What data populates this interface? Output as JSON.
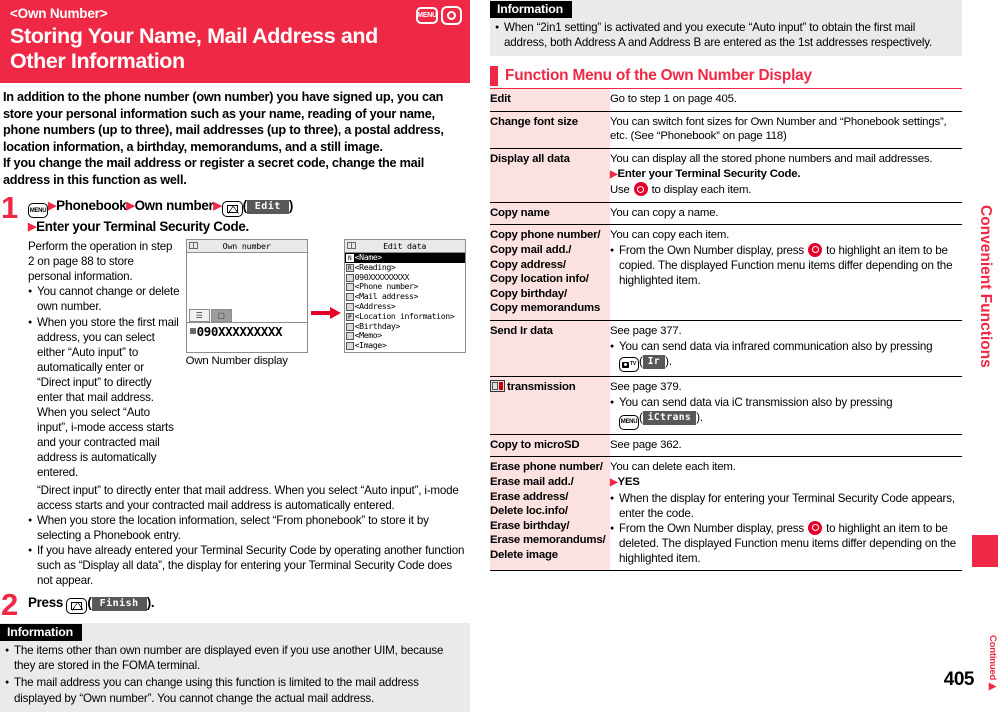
{
  "header": {
    "chapter_tag": "<Own Number>",
    "title_line1": "Storing Your Name, Mail Address and",
    "title_line2": "Other Information",
    "key_menu_label": "MENU",
    "accent_color": "#ef2945"
  },
  "intro": {
    "paragraph1": "In addition to the phone number (own number) you have signed up, you can store your personal information such as your name, reading of your name, phone numbers (up to three), mail addresses (up to three), a postal address, location information, a birthday, memorandums, and a still image.",
    "paragraph2": "If you change the mail address or register a secret code, change the mail address in this function as well."
  },
  "steps": [
    {
      "number": "1",
      "head_parts": {
        "key1": "MENU",
        "item1": "Phonebook",
        "item2": "Own number",
        "softkey": "Edit",
        "line2": "Enter your Terminal Security Code."
      },
      "body": "Perform the operation in step 2 on page 88 to store personal information.",
      "bullets": [
        "You cannot change or delete own number.",
        "When you store the first mail address, you can select either “Auto input” to automatically enter or “Direct input” to directly enter that mail address. When you select “Auto input”, i-mode access starts and your contracted mail address is automatically entered.",
        "When you store the location information, select “From phonebook” to store it by selecting a Phonebook entry.",
        "If you have already entered your Terminal Security Code by operating another function such as “Display all data”, the display for entering your Terminal Security Code does not appear."
      ]
    },
    {
      "number": "2",
      "head_parts": {
        "press_label": "Press",
        "softkey": "Finish",
        "trailing": ")."
      }
    }
  ],
  "screens": {
    "own_number": {
      "title": "Own number",
      "number": "090XXXXXXXXX",
      "tab_list_icon": "list-icon",
      "tab_photo_icon": "photo-icon"
    },
    "edit_data": {
      "title": "Edit data",
      "rows": [
        {
          "icon": "N",
          "label": "<Name>",
          "highlighted": true
        },
        {
          "icon": "R",
          "label": "<Reading>",
          "highlighted": false
        },
        {
          "icon": "☎",
          "label": "090XXXXXXXXX",
          "highlighted": false
        },
        {
          "icon": "☎",
          "label": "<Phone number>",
          "highlighted": false
        },
        {
          "icon": "✉",
          "label": "<Mail address>",
          "highlighted": false
        },
        {
          "icon": "■",
          "label": "<Address>",
          "highlighted": false
        },
        {
          "icon": "P",
          "label": "<Location information>",
          "highlighted": false
        },
        {
          "icon": "♪",
          "label": "<Birthday>",
          "highlighted": false
        },
        {
          "icon": "□",
          "label": "<Memo>",
          "highlighted": false
        },
        {
          "icon": "▣",
          "label": "<Image>",
          "highlighted": false
        }
      ]
    },
    "caption": "Own Number display"
  },
  "info_left": {
    "heading": "Information",
    "bullets": [
      "The items other than own number are displayed even if you use another UIM, because they are stored in the FOMA terminal.",
      "The mail address you can change using this function is limited to the mail address displayed by “Own number”. You cannot change the actual mail address."
    ]
  },
  "info_right": {
    "heading": "Information",
    "bullets": [
      "When “2in1 setting” is activated and you execute “Auto input” to obtain the first mail address, both Address A and Address B are entered as the 1st addresses respectively."
    ]
  },
  "function_menu": {
    "heading": "Function Menu of the Own Number Display",
    "rows": [
      {
        "name": "Edit",
        "desc_lines": [
          "Go to step 1 on page 405."
        ]
      },
      {
        "name": "Change font size",
        "desc_lines": [
          "You can switch font sizes for Own Number and “Phonebook settings”, etc. (See “Phonebook” on page 118)"
        ]
      },
      {
        "name": "Display all data",
        "desc_lines": [
          "You can display all the stored phone numbers and mail addresses."
        ],
        "sub_arrow": "Enter your Terminal Security Code.",
        "use_prefix": "Use",
        "use_suffix": "to display each item.",
        "use_icon": "control-key-icon"
      },
      {
        "name": "Copy name",
        "desc_lines": [
          "You can copy a name."
        ]
      },
      {
        "name": "Copy phone number/\nCopy mail add./\nCopy address/\nCopy location info/\nCopy birthday/\nCopy memorandums",
        "desc_lines": [
          "You can copy each item."
        ],
        "bullet_prefix": "From the Own Number display, press",
        "bullet_suffix": "to highlight an item to be copied. The displayed Function menu items differ depending on the highlighted item.",
        "bullet_icon": "control-key-icon"
      },
      {
        "name": "Send Ir data",
        "desc_lines": [
          "See page 377."
        ],
        "bullet_prefix": "You can send data via infrared communication also by pressing",
        "bullet_key_icon": "camera-tv-key-icon",
        "bullet_softkey": "Ir",
        "bullet_suffix": ")."
      },
      {
        "name": "transmission",
        "name_icon": "ic-transmission-icon",
        "desc_lines": [
          "See page 379."
        ],
        "bullet_prefix": "You can send data via iC transmission also by pressing",
        "bullet_key_icon": "menu-key-icon",
        "bullet_softkey": "iCtrans",
        "bullet_suffix": ")."
      },
      {
        "name": "Copy to microSD",
        "desc_lines": [
          "See page 362."
        ]
      },
      {
        "name": "Erase phone number/\nErase mail add./\nErase address/\nDelete loc.info/\nErase birthday/\nErase memorandums/\nDelete image",
        "desc_lines": [
          "You can delete each item."
        ],
        "sub_arrow": "YES",
        "bullets": [
          "When the display for entering your Terminal Security Code appears, enter the code.",
          "From the Own Number display, press ○ to highlight an item to be deleted. The displayed Function menu items differ depending on the highlighted item."
        ],
        "bullet2_prefix": "From the Own Number display, press",
        "bullet2_suffix": "to highlight an item to be deleted. The displayed Function menu items differ depending on the highlighted item."
      }
    ]
  },
  "side_tab": {
    "label": "Convenient Functions"
  },
  "footer": {
    "page_number": "405",
    "continued": "Continued"
  }
}
